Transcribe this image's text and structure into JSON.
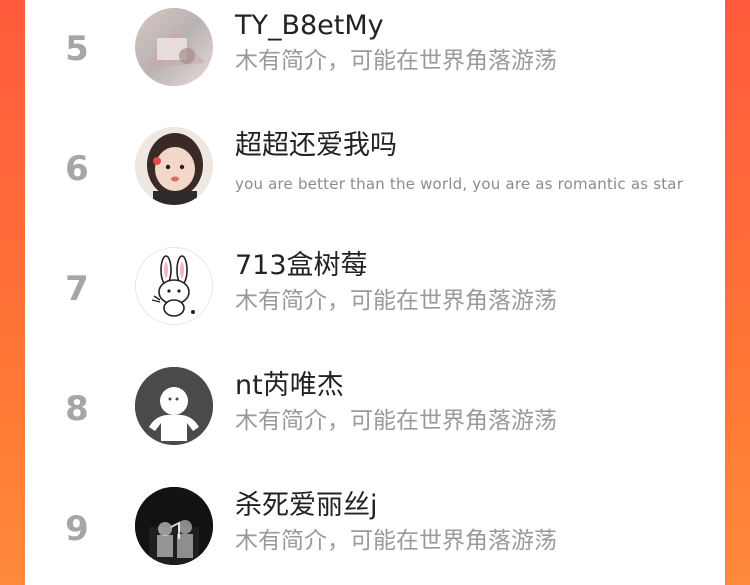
{
  "ranking": {
    "rows": [
      {
        "rank": "5",
        "name": "TY_B8etMy",
        "bio": "木有简介，可能在世界角落游荡",
        "avatar": "photo-avatar-icon"
      },
      {
        "rank": "6",
        "name": "超超还爱我吗",
        "bio": "you are better than the world, you are as romantic as star",
        "avatar": "girl-photo-avatar-icon"
      },
      {
        "rank": "7",
        "name": "713盒树莓",
        "bio": "木有简介，可能在世界角落游荡",
        "avatar": "bunny-avatar-icon"
      },
      {
        "rank": "8",
        "name": "nt芮唯杰",
        "bio": "木有简介，可能在世界角落游荡",
        "avatar": "default-user-avatar-icon"
      },
      {
        "rank": "9",
        "name": "杀死爱丽丝j",
        "bio": "木有简介，可能在世界角落游荡",
        "avatar": "dark-photo-avatar-icon"
      }
    ]
  },
  "colors": {
    "background_gradient_start": "#ff5a3c",
    "background_gradient_end": "#ff8a3b",
    "rank_text": "#a6a6a6",
    "name_text": "#222222",
    "bio_text": "#9a9a9a"
  }
}
